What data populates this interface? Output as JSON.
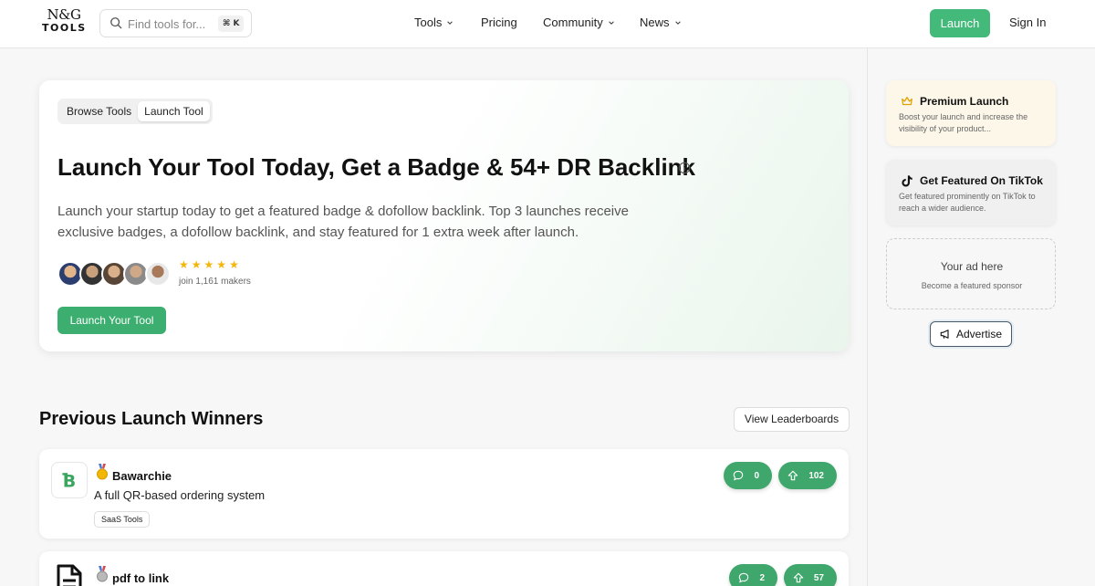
{
  "header": {
    "logo_top": "N&G",
    "logo_bottom": "TOOLS",
    "search_placeholder": "Find tools for...",
    "search_shortcut": "⌘ K",
    "nav": [
      "Tools",
      "Pricing",
      "Community",
      "News"
    ],
    "launch_label": "Launch",
    "signin_label": "Sign In"
  },
  "hero": {
    "tabs": [
      "Browse Tools",
      "Launch Tool"
    ],
    "active_tab": "Launch Tool",
    "title": "Launch Your Tool Today, Get a Badge & 54+ DR Backlink",
    "description": "Launch your startup today to get a featured badge & dofollow backlink. Top 3 launches receive exclusive badges, a dofollow backlink, and stay featured for 1 extra week after launch.",
    "rating_stars": 5,
    "makers_text": "join 1,161 makers",
    "cta_label": "Launch Your Tool"
  },
  "winners": {
    "title": "Previous Launch Winners",
    "leaderboard_label": "View Leaderboards",
    "items": [
      {
        "name": "Bawarchie",
        "description": "A full QR-based ordering system",
        "tag": "SaaS Tools",
        "comments": "0",
        "upvotes": "102",
        "medal": "gold"
      },
      {
        "name": "pdf to link",
        "comments": "2",
        "upvotes": "57",
        "medal": "silver"
      }
    ]
  },
  "sidebar": {
    "premium_title": "Premium Launch",
    "premium_desc": "Boost your launch and increase the visibility of your product...",
    "tiktok_title": "Get Featured On TikTok",
    "tiktok_desc": "Get featured prominently on TikTok to reach a wider audience.",
    "ad_title": "Your ad here",
    "ad_sub": "Become a featured sponsor",
    "advertise_label": "Advertise"
  },
  "colors": {
    "accent_green": "#43b97a",
    "pill_green": "#3fa66c",
    "star_gold": "#f5b50a"
  }
}
